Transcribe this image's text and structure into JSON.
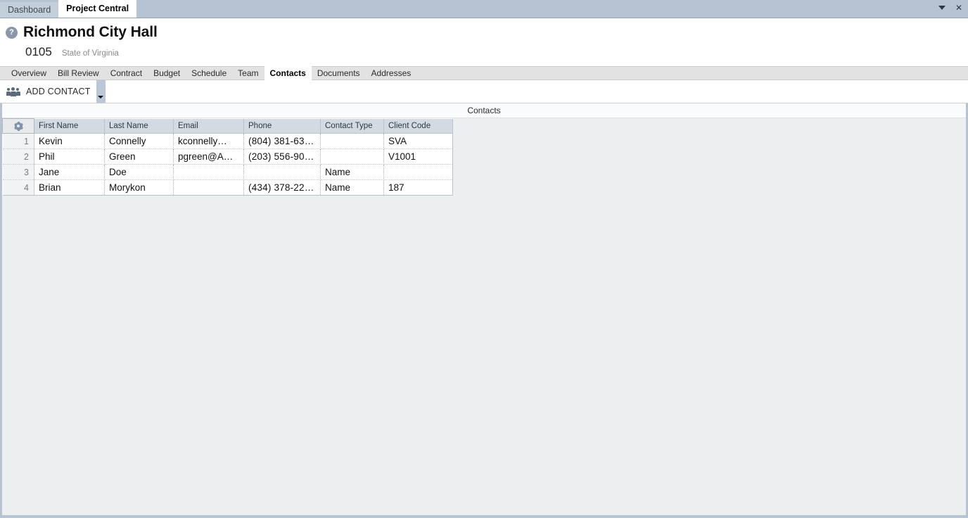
{
  "window": {
    "tabs": [
      {
        "label": "Dashboard",
        "active": false
      },
      {
        "label": "Project Central",
        "active": true
      }
    ],
    "controls": {
      "dropdown_icon": "caret-down-icon",
      "close_label": "✕"
    }
  },
  "header": {
    "help_icon_label": "?",
    "title": "Richmond City Hall",
    "project_number": "0105",
    "client_name": "State of Virginia"
  },
  "section_nav": {
    "items": [
      {
        "label": "Overview",
        "active": false
      },
      {
        "label": "Bill Review",
        "active": false
      },
      {
        "label": "Contract",
        "active": false
      },
      {
        "label": "Budget",
        "active": false
      },
      {
        "label": "Schedule",
        "active": false
      },
      {
        "label": "Team",
        "active": false
      },
      {
        "label": "Contacts",
        "active": true
      },
      {
        "label": "Documents",
        "active": false
      },
      {
        "label": "Addresses",
        "active": false
      }
    ]
  },
  "toolbar": {
    "add_contact_label": "ADD CONTACT",
    "add_contact_icon": "people-icon",
    "dropdown_icon": "triangle-down-icon"
  },
  "panel": {
    "title": "Contacts",
    "settings_icon": "gear-icon"
  },
  "grid": {
    "columns": [
      "First Name",
      "Last Name",
      "Email",
      "Phone",
      "Contact Type",
      "Client  Code"
    ],
    "rows": [
      {
        "num": "1",
        "first_name": "Kevin",
        "last_name": "Connelly",
        "email": "kconnelly…",
        "phone": "(804)  381-63…",
        "contact_type": "",
        "client_code": "SVA"
      },
      {
        "num": "2",
        "first_name": "Phil",
        "last_name": "Green",
        "email": "pgreen@A…",
        "phone": "(203)  556-90…",
        "contact_type": "",
        "client_code": "V1001"
      },
      {
        "num": "3",
        "first_name": "Jane",
        "last_name": "Doe",
        "email": "",
        "phone": "",
        "contact_type": "Name",
        "client_code": ""
      },
      {
        "num": "4",
        "first_name": "Brian",
        "last_name": "Morykon",
        "email": "",
        "phone": "(434)  378-22…",
        "contact_type": "Name",
        "client_code": "187"
      }
    ]
  },
  "colors": {
    "window_chrome": "#b6c3d2",
    "section_nav_bg": "#e2e2e2",
    "content_bg": "#eceeef",
    "grid_header_bg": "#d3dae1",
    "accent_icon": "#7d93ab"
  }
}
